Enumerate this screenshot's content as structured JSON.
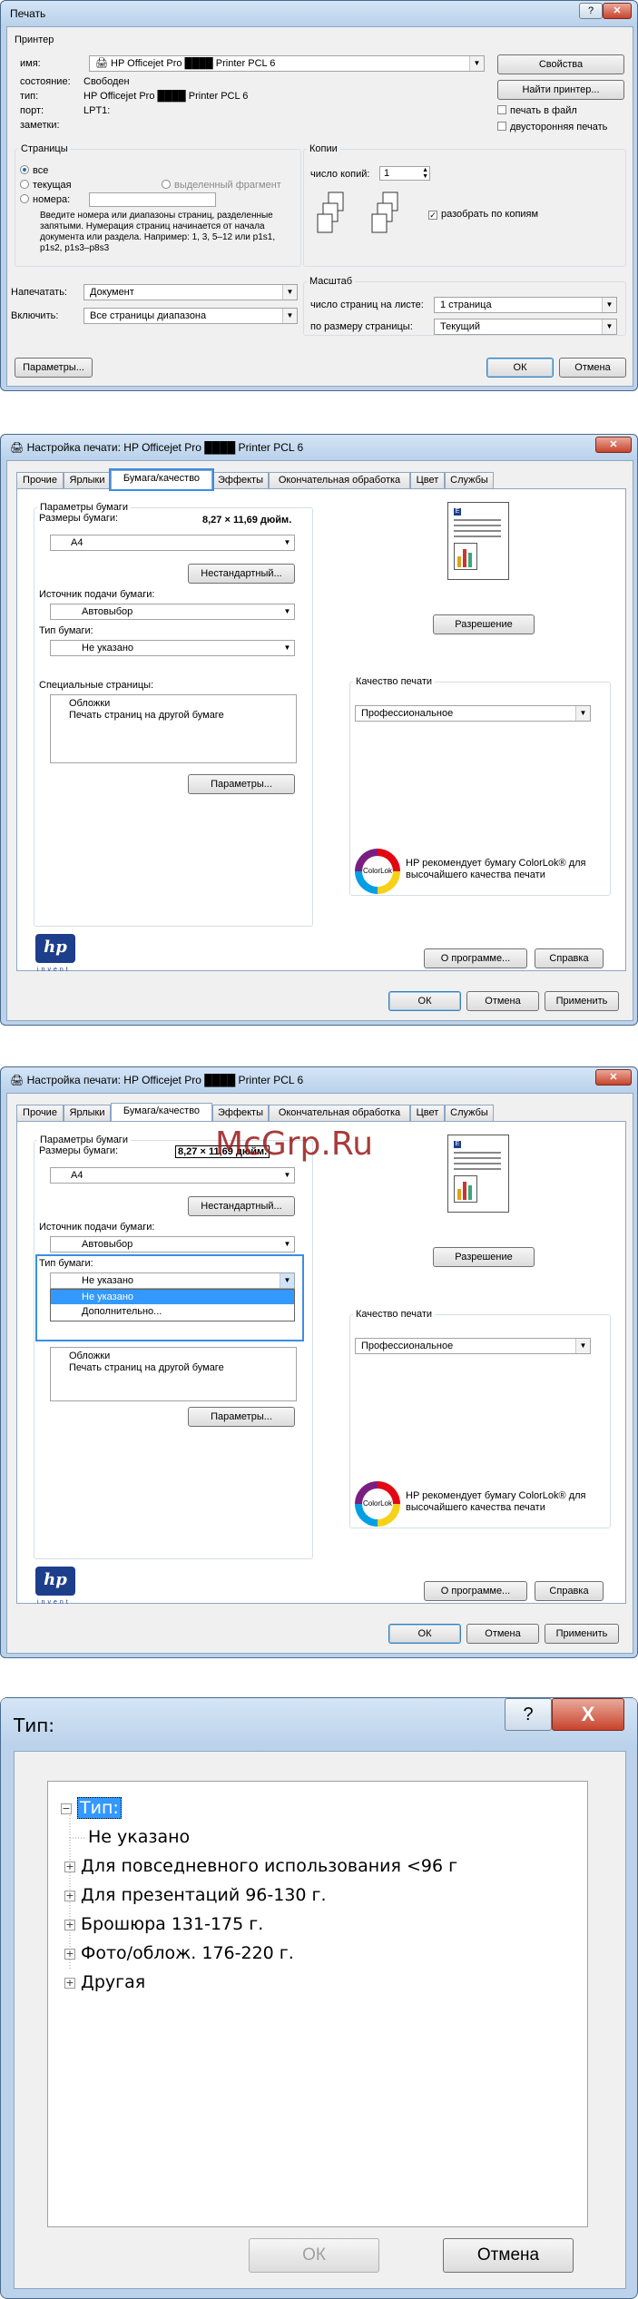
{
  "print_dialog": {
    "title": "Печать",
    "printer_group": "Принтер",
    "name_label": "имя:",
    "printer_name": "HP Officejet Pro ████ Printer PCL 6",
    "properties_button": "Свойства",
    "status_label": "состояние:",
    "status_value": "Свободен",
    "find_printer_button": "Найти принтер...",
    "type_label": "тип:",
    "type_value": "HP Officejet Pro ████ Printer PCL 6",
    "port_label": "порт:",
    "port_value": "LPT1:",
    "notes_label": "заметки:",
    "print_to_file": "печать в файл",
    "duplex": "двусторонняя печать",
    "pages_group": "Страницы",
    "all": "все",
    "current": "текущая",
    "selection": "выделенный фрагмент",
    "pages": "номера:",
    "pages_hint": "Введите номера или диапазоны страниц, разделенные запятыми. Нумерация страниц начинается от начала документа или раздела. Например: 1, 3, 5–12 или p1s1, p1s2, p1s3–p8s3",
    "copies_group": "Копии",
    "copies_label": "число копий:",
    "copies_value": "1",
    "collate": "разобрать по копиям",
    "print_what_label": "Напечатать:",
    "print_what_value": "Документ",
    "include_label": "Включить:",
    "include_value": "Все страницы диапазона",
    "zoom_group": "Масштаб",
    "pages_per_sheet_label": "число страниц на листе:",
    "pages_per_sheet_value": "1 страница",
    "scale_label": "по размеру страницы:",
    "scale_value": "Текущий",
    "options_button": "Параметры...",
    "ok": "ОК",
    "cancel": "Отмена"
  },
  "prefs_dialog": {
    "title": "Настройка печати: HP Officejet Pro ████ Printer PCL 6",
    "tabs": [
      "Прочие",
      "Ярлыки",
      "Бумага/качество",
      "Эффекты",
      "Окончательная обработка",
      "Цвет",
      "Службы"
    ],
    "paper_options": "Параметры бумаги",
    "paper_sizes_label": "Размеры бумаги:",
    "paper_size_dim": "8,27 × 11,69 дюйм.",
    "paper_size_value": "A4",
    "custom_button": "Нестандартный...",
    "paper_source_label": "Источник подачи бумаги:",
    "paper_source_value": "Автовыбор",
    "paper_type_label": "Тип бумаги:",
    "paper_type_value": "Не указано",
    "special_pages_label": "Специальные страницы:",
    "special_pages_items": [
      "Обложки",
      "Печать страниц на другой бумаге"
    ],
    "settings_button": "Параметры...",
    "resolution_button": "Разрешение",
    "print_quality_group": "Качество печати",
    "print_quality_value": "Профессиональное",
    "colorlok_text": "HP рекомендует бумагу ColorLok® для высочайшего качества печати",
    "colorlok_logo": "ColorLok",
    "about_button": "О программе...",
    "help_button": "Справка",
    "ok": "ОК",
    "cancel": "Отмена",
    "apply": "Применить",
    "hp_logo": "hp",
    "hp_invent": "invent",
    "dropdown_options": [
      "Не указано",
      "Дополнительно..."
    ]
  },
  "type_dialog": {
    "title": "Тип:",
    "root": "Тип:",
    "items": [
      {
        "label": "Не указано",
        "expandable": false
      },
      {
        "label": "Для повседневного использования <96 г",
        "expandable": true
      },
      {
        "label": "Для презентаций 96-130 г.",
        "expandable": true
      },
      {
        "label": "Брошюра 131-175 г.",
        "expandable": true
      },
      {
        "label": "Фото/облож. 176-220 г.",
        "expandable": true
      },
      {
        "label": "Другая",
        "expandable": true
      }
    ],
    "ok": "ОК",
    "cancel": "Отмена",
    "help_glyph": "?",
    "close_glyph": "X"
  },
  "watermark": "McGrp.Ru"
}
